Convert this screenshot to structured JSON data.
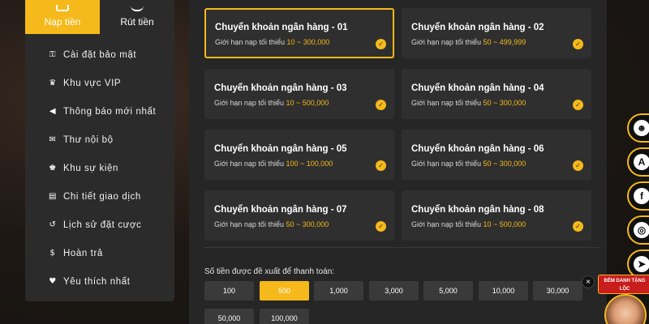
{
  "sidebar": {
    "tabs": [
      {
        "label": "Nạp tiền",
        "icon": "deposit-icon",
        "active": true
      },
      {
        "label": "Rút tiền",
        "icon": "withdraw-icon",
        "active": false
      }
    ],
    "items": [
      {
        "label": "Cài đặt bảo mật",
        "icon": "shield-icon"
      },
      {
        "label": "Khu vực VIP",
        "icon": "crown-icon"
      },
      {
        "label": "Thông báo mới nhất",
        "icon": "megaphone-icon"
      },
      {
        "label": "Thư nội bộ",
        "icon": "mail-icon"
      },
      {
        "label": "Khu sự kiện",
        "icon": "trophy-icon"
      },
      {
        "label": "Chi tiết giao dịch",
        "icon": "document-icon"
      },
      {
        "label": "Lịch sử đặt cược",
        "icon": "history-icon"
      },
      {
        "label": "Hoàn trả",
        "icon": "dollar-icon"
      },
      {
        "label": "Yêu thích nhất",
        "icon": "heart-icon"
      }
    ]
  },
  "banks": {
    "limit_prefix": "Giới hạn nạp tối thiểu",
    "items": [
      {
        "title": "Chuyển khoản ngân hàng - 01",
        "range": "10 ~ 300,000",
        "selected": true
      },
      {
        "title": "Chuyển khoản ngân hàng - 02",
        "range": "50 ~ 499,999",
        "selected": false
      },
      {
        "title": "Chuyển khoản ngân hàng - 03",
        "range": "10 ~ 500,000",
        "selected": false
      },
      {
        "title": "Chuyển khoản ngân hàng - 04",
        "range": "50 ~ 300,000",
        "selected": false
      },
      {
        "title": "Chuyển khoản ngân hàng - 05",
        "range": "100 ~ 100,000",
        "selected": false
      },
      {
        "title": "Chuyển khoản ngân hàng - 06",
        "range": "50 ~ 300,000",
        "selected": false
      },
      {
        "title": "Chuyển khoản ngân hàng - 07",
        "range": "50 ~ 300,000",
        "selected": false
      },
      {
        "title": "Chuyển khoản ngân hàng - 08",
        "range": "10 ~ 500,000",
        "selected": false
      }
    ]
  },
  "suggest": {
    "label": "Số tiền được đề xuất để thanh toán:",
    "amounts": [
      "100",
      "500",
      "1,000",
      "3,000",
      "5,000",
      "10,000",
      "30,000",
      "50,000",
      "100,000"
    ],
    "selected": "500"
  },
  "floating": {
    "close": "×",
    "social": [
      {
        "icon": "support-icon",
        "glyph": "☻"
      },
      {
        "icon": "app-icon",
        "glyph": "A"
      },
      {
        "icon": "facebook-icon",
        "glyph": "f"
      },
      {
        "icon": "instagram-icon",
        "glyph": "◎"
      },
      {
        "icon": "telegram-icon",
        "glyph": "➤"
      }
    ],
    "promo_text": "ĐẾM DANH TẶNG LỘC"
  },
  "colors": {
    "accent": "#f5b91b",
    "panel": "#2b2b2b",
    "card": "#2f2f2f"
  }
}
